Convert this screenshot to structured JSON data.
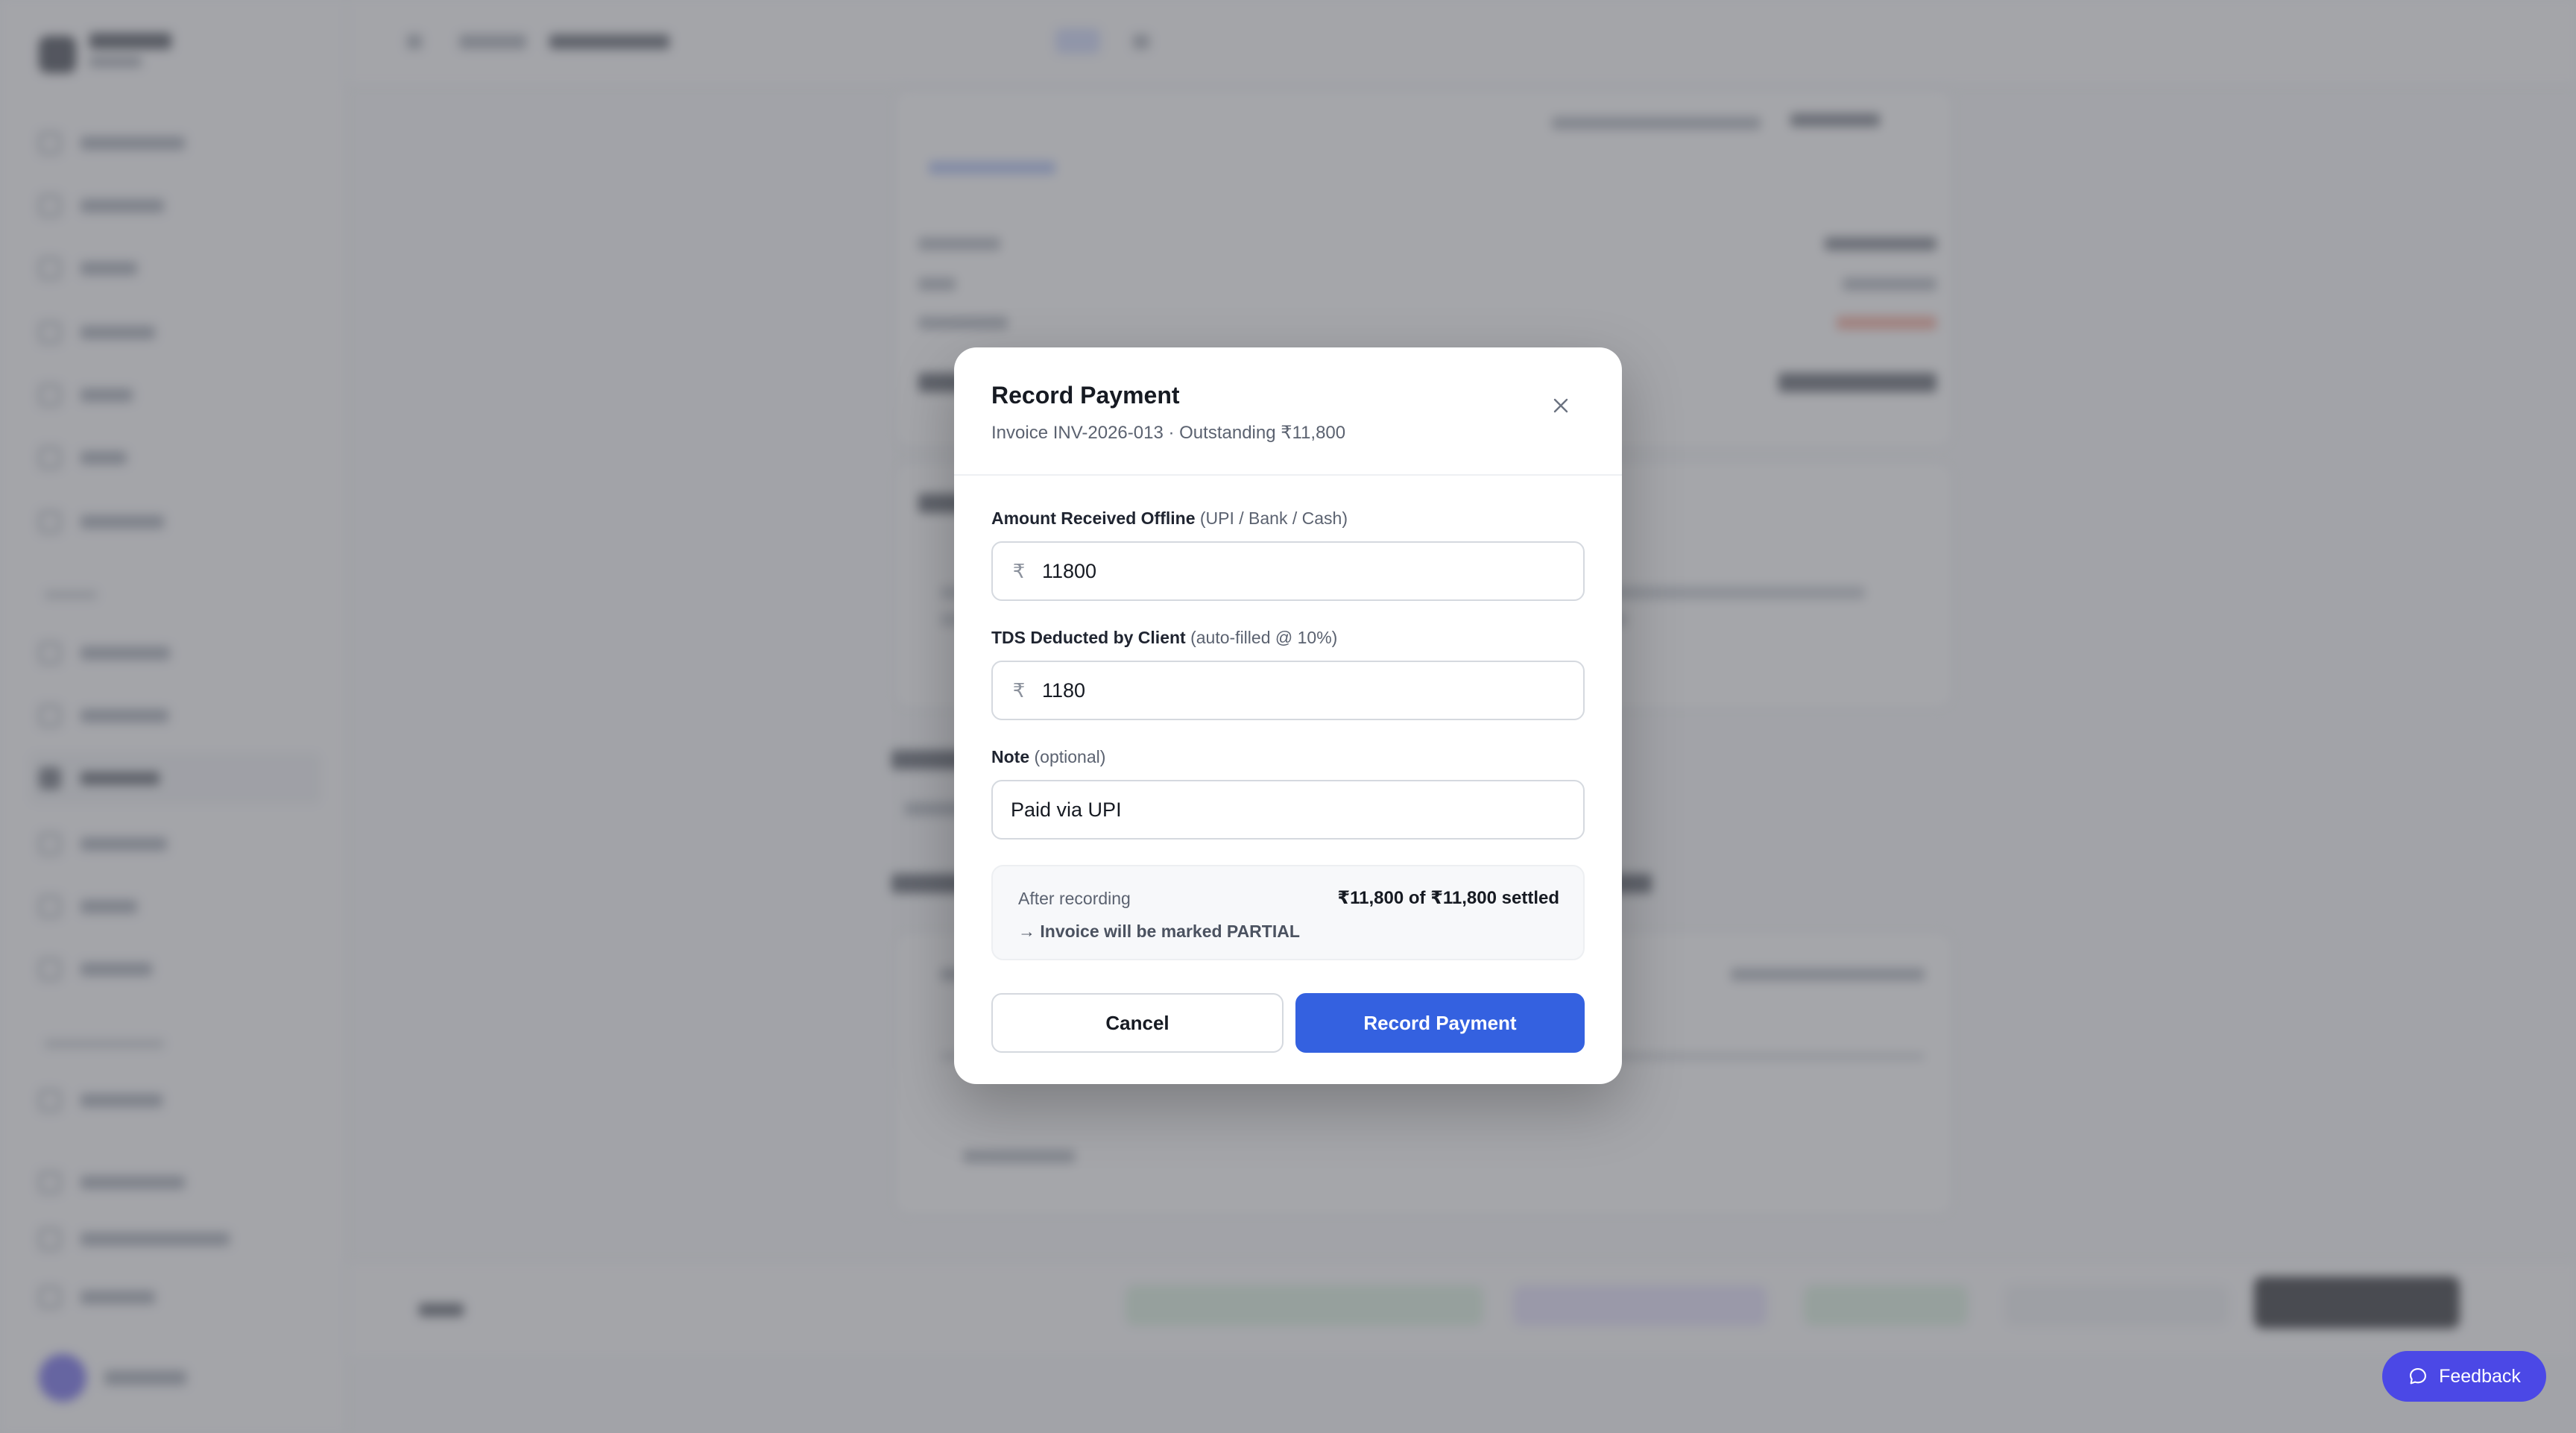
{
  "modal": {
    "title": "Record Payment",
    "subtitle": "Invoice INV-2026-013 · Outstanding ₹11,800",
    "close_icon": "close-icon",
    "amount_field": {
      "label": "Amount Received Offline",
      "hint": "(UPI / Bank / Cash)",
      "currency": "₹",
      "value": "11800"
    },
    "tds_field": {
      "label": "TDS Deducted by Client",
      "hint": "(auto-filled @ 10%)",
      "currency": "₹",
      "value": "1180"
    },
    "note_field": {
      "label": "Note",
      "hint": "(optional)",
      "value": "Paid via UPI"
    },
    "summary": {
      "label": "After recording",
      "value": "₹11,800 of ₹11,800 settled",
      "note": "→ Invoice will be marked PARTIAL"
    },
    "cancel_label": "Cancel",
    "submit_label": "Record Payment"
  },
  "feedback": {
    "label": "Feedback",
    "icon": "chat-bubble-icon"
  },
  "colors": {
    "primary": "#3461e0",
    "feedback": "#4b48e6",
    "overlay": "rgba(110,112,118,0.62)"
  }
}
